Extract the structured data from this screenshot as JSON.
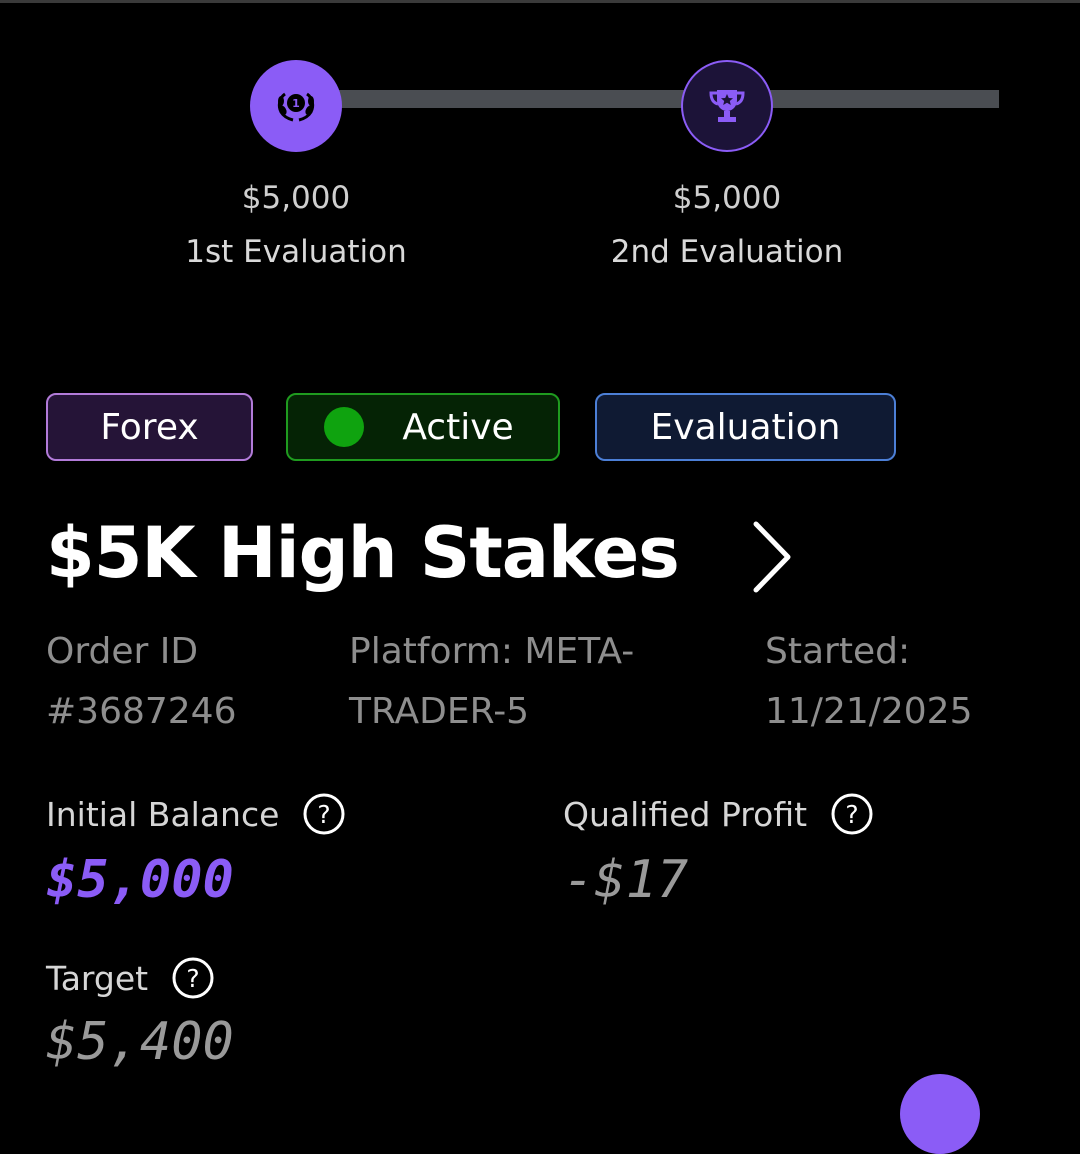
{
  "steps": [
    {
      "amount": "$5,000",
      "label": "1st Evaluation",
      "icon": "laurel-medal-icon"
    },
    {
      "amount": "$5,000",
      "label": "2nd Evaluation",
      "icon": "trophy-icon"
    }
  ],
  "badges": {
    "forex": "Forex",
    "active": "Active",
    "evaluation": "Evaluation"
  },
  "account": {
    "title": "$5K High Stakes",
    "order_id_label": "Order ID",
    "order_id": "#3687246",
    "platform_line1": "Platform: META-",
    "platform_line2": "TRADER-5",
    "started_label": "Started:",
    "started_date": "11/21/2025"
  },
  "stats": {
    "initial_balance_label": "Initial Balance",
    "initial_balance": "$5,000",
    "qualified_profit_label": "Qualified Profit",
    "qualified_profit": "-$17",
    "target_label": "Target",
    "target": "$5,400"
  },
  "colors": {
    "accent": "#8b5cf6",
    "active_green": "#0fa30f",
    "background": "#000000"
  }
}
